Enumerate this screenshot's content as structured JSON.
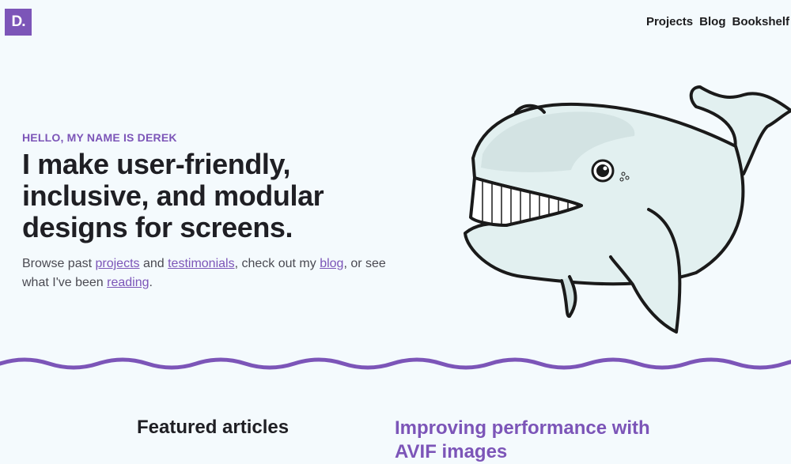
{
  "logo": {
    "text": "D."
  },
  "nav": {
    "items": [
      "Projects",
      "Blog",
      "Bookshelf"
    ]
  },
  "hero": {
    "eyebrow": "HELLO, MY NAME IS DEREK",
    "headline": "I make user-friendly, inclusive, and modular designs for screens.",
    "intro": {
      "t1": "Browse past ",
      "link_projects": "projects",
      "t2": " and ",
      "link_testimonials": "testimonials",
      "t3": ", check out my ",
      "link_blog": "blog",
      "t4": ", or see what I've been ",
      "link_reading": "reading",
      "t5": "."
    }
  },
  "featured": {
    "heading": "Featured articles",
    "first_article_title": "Improving performance with AVIF images"
  },
  "colors": {
    "accent": "#7c55b8",
    "background": "#f4fafd",
    "text": "#1c1c1e"
  },
  "illustration": {
    "icon": "whale-icon"
  }
}
